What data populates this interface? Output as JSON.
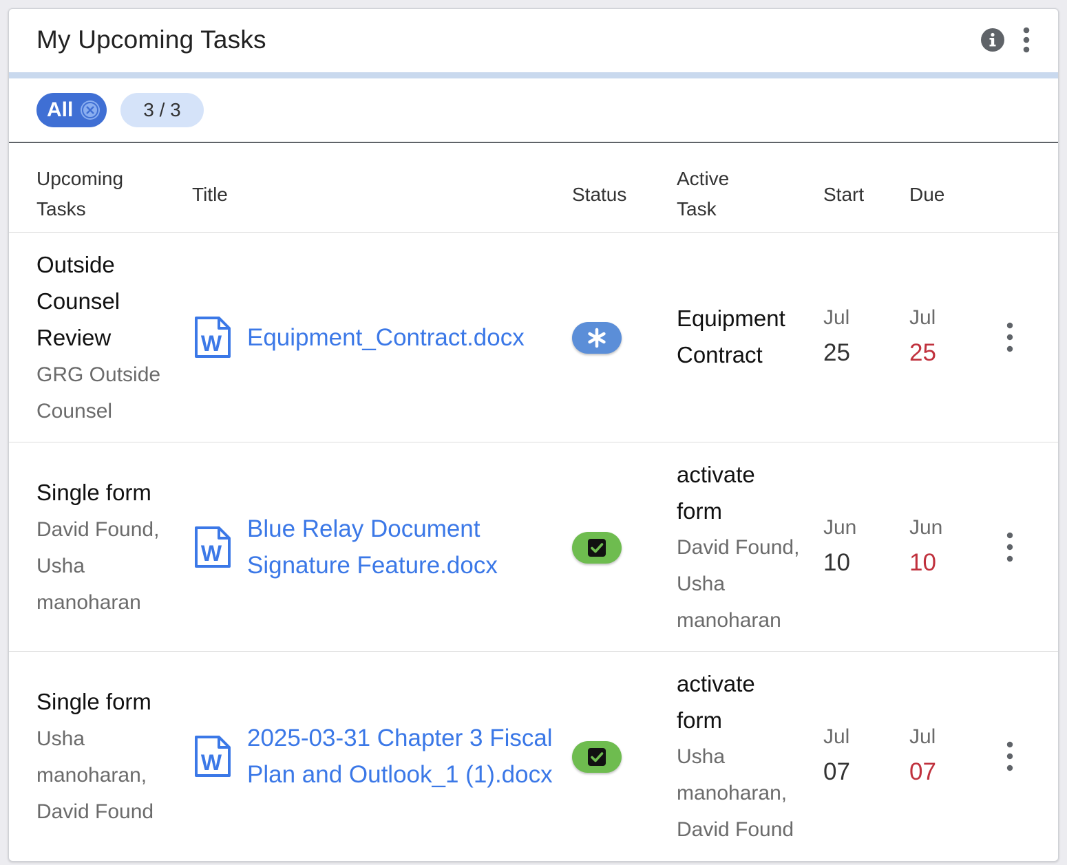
{
  "widget": {
    "title": "My Upcoming Tasks",
    "icons": {
      "info": "info-circle-icon",
      "menu": "more-vertical-icon"
    }
  },
  "filters": {
    "all_chip": {
      "label": "All",
      "clear_icon": "close-circle-icon"
    },
    "count": "3 / 3"
  },
  "table": {
    "headers": {
      "upcoming_tasks": [
        "Upcoming",
        "Tasks"
      ],
      "title": "Title",
      "status": "Status",
      "active_task": [
        "Active",
        "Task"
      ],
      "start": "Start",
      "due": "Due"
    },
    "rows": [
      {
        "task_lines": [
          "Outside",
          "Counsel",
          "Review"
        ],
        "assignee_lines": [
          "GRG Outside",
          "Counsel"
        ],
        "file_icon": "word-document-icon",
        "title_lines": [
          "Equipment_Contract.docx"
        ],
        "status": {
          "icon": "asterisk-icon",
          "color": "#5b8ed8"
        },
        "active_lines": [
          "Equipment",
          "Contract"
        ],
        "active_assignee_lines": [],
        "start": {
          "month": "Jul",
          "day": "25"
        },
        "due": {
          "month": "Jul",
          "day": "25"
        }
      },
      {
        "task_lines": [
          "Single form"
        ],
        "assignee_lines": [
          "David Found,",
          "Usha",
          "manoharan"
        ],
        "file_icon": "word-document-icon",
        "title_lines": [
          "Blue Relay Document",
          "Signature Feature.docx"
        ],
        "status": {
          "icon": "checkbox-checked-icon",
          "color": "#6ebc4f"
        },
        "active_lines": [
          "activate",
          "form"
        ],
        "active_assignee_lines": [
          "David Found,",
          "Usha",
          "manoharan"
        ],
        "start": {
          "month": "Jun",
          "day": "10"
        },
        "due": {
          "month": "Jun",
          "day": "10"
        }
      },
      {
        "task_lines": [
          "Single form"
        ],
        "assignee_lines": [
          "Usha",
          "manoharan,",
          "David Found"
        ],
        "file_icon": "word-document-icon",
        "title_lines": [
          "2025-03-31 Chapter 3 Fiscal",
          "Plan and Outlook_1 (1).docx"
        ],
        "status": {
          "icon": "checkbox-checked-icon",
          "color": "#6ebc4f"
        },
        "active_lines": [
          "activate",
          "form"
        ],
        "active_assignee_lines": [
          "Usha",
          "manoharan,",
          "David Found"
        ],
        "start": {
          "month": "Jul",
          "day": "07"
        },
        "due": {
          "month": "Jul",
          "day": "07"
        }
      }
    ]
  },
  "colors": {
    "accent": "#3f6fd4",
    "link": "#3b78e7",
    "overdue": "#c0313d",
    "chip_light": "#d5e3f9",
    "status_in_progress": "#5b8ed8",
    "status_complete": "#6ebc4f"
  }
}
